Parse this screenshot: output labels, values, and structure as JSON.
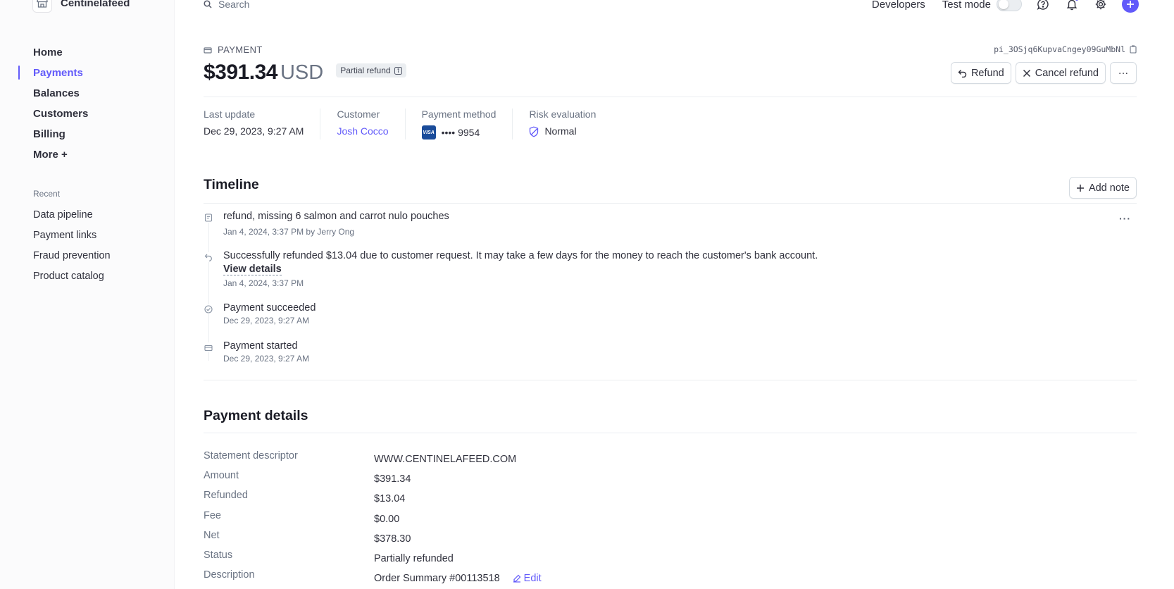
{
  "app": {
    "name": "Centinelafeed"
  },
  "sidebar": {
    "items": [
      {
        "label": "Home"
      },
      {
        "label": "Payments"
      },
      {
        "label": "Balances"
      },
      {
        "label": "Customers"
      },
      {
        "label": "Billing"
      },
      {
        "label": "More +"
      }
    ],
    "recent_title": "Recent",
    "recent": [
      {
        "label": "Data pipeline"
      },
      {
        "label": "Payment links"
      },
      {
        "label": "Fraud prevention"
      },
      {
        "label": "Product catalog"
      }
    ]
  },
  "topbar": {
    "search_placeholder": "Search",
    "developers": "Developers",
    "test_mode": "Test mode"
  },
  "payment": {
    "kicker": "PAYMENT",
    "id": "pi_3OSjq6KupvaCngey09GuMbNl",
    "amount": "$391.34",
    "currency": "USD",
    "badge": "Partial refund",
    "actions": {
      "refund": "Refund",
      "cancel_refund": "Cancel refund",
      "more": "···"
    }
  },
  "meta": {
    "last_update_label": "Last update",
    "last_update": "Dec 29, 2023, 9:27 AM",
    "customer_label": "Customer",
    "customer": "Josh Cocco",
    "method_label": "Payment method",
    "method": "•••• 9954",
    "card_brand": "VISA",
    "risk_label": "Risk evaluation",
    "risk": "Normal"
  },
  "timeline": {
    "title": "Timeline",
    "add_note": "Add note",
    "events": [
      {
        "text": "refund, missing 6 salmon and carrot nulo pouches",
        "sub": "Jan 4, 2024, 3:37 PM by Jerry Ong",
        "icon": "note-icon"
      },
      {
        "text": "Successfully refunded $13.04 due to customer request. It may take a few days for the money to reach the customer's bank account.",
        "link": "View details",
        "sub": "Jan 4, 2024, 3:37 PM",
        "icon": "refund-icon"
      },
      {
        "text": "Payment succeeded",
        "sub": "Dec 29, 2023, 9:27 AM",
        "icon": "check-icon"
      },
      {
        "text": "Payment started",
        "sub": "Dec 29, 2023, 9:27 AM",
        "icon": "card-icon"
      }
    ]
  },
  "details": {
    "title": "Payment details",
    "rows": [
      {
        "label": "Statement descriptor",
        "value": "WWW.CENTINELAFEED.COM"
      },
      {
        "label": "Amount",
        "value": "$391.34"
      },
      {
        "label": "Refunded",
        "value": "$13.04"
      },
      {
        "label": "Fee",
        "value": "$0.00"
      },
      {
        "label": "Net",
        "value": "$378.30"
      },
      {
        "label": "Status",
        "value": "Partially refunded"
      },
      {
        "label": "Description",
        "value": "Order Summary #00113518"
      }
    ],
    "edit": "Edit"
  },
  "colors": {
    "accent": "#625afa",
    "text": "#30313d",
    "muted": "#6a7383",
    "border": "#ebeef1"
  }
}
